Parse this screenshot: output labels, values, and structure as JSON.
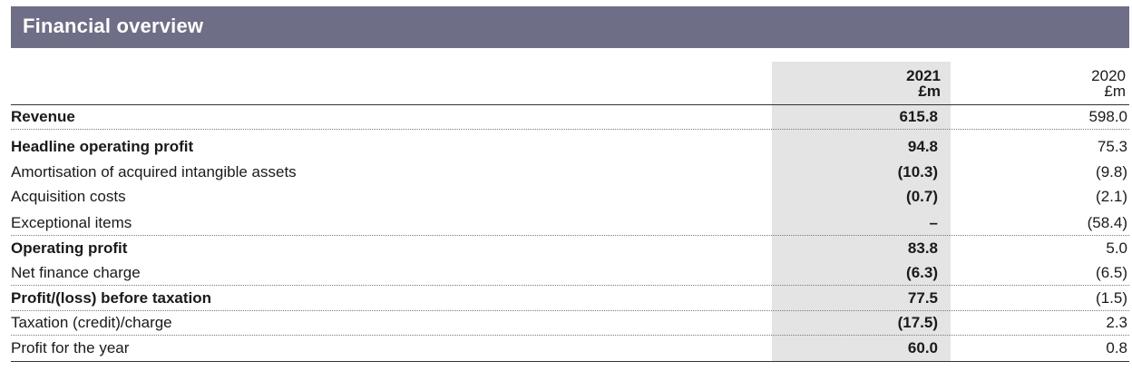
{
  "title": "Financial overview",
  "columns": [
    {
      "year": "2021",
      "unit": "£m"
    },
    {
      "year": "2020",
      "unit": "£m"
    }
  ],
  "rows": [
    {
      "label": "Revenue",
      "v2021": "615.8",
      "v2020": "598.0",
      "bold": true
    },
    {
      "label": "Headline operating profit",
      "v2021": "94.8",
      "v2020": "75.3",
      "bold": true
    },
    {
      "label": "Amortisation of acquired intangible assets",
      "v2021": "(10.3)",
      "v2020": "(9.8)",
      "bold": false
    },
    {
      "label": "Acquisition costs",
      "v2021": "(0.7)",
      "v2020": "(2.1)",
      "bold": false
    },
    {
      "label": "Exceptional items",
      "v2021": "–",
      "v2020": "(58.4)",
      "bold": false
    },
    {
      "label": "Operating profit",
      "v2021": "83.8",
      "v2020": "5.0",
      "bold": true
    },
    {
      "label": "Net finance charge",
      "v2021": "(6.3)",
      "v2020": "(6.5)",
      "bold": false
    },
    {
      "label": "Profit/(loss) before taxation",
      "v2021": "77.5",
      "v2020": "(1.5)",
      "bold": true
    },
    {
      "label": "Taxation (credit)/charge",
      "v2021": "(17.5)",
      "v2020": "2.3",
      "bold": false
    },
    {
      "label": "Profit for the year",
      "v2021": "60.0",
      "v2020": "0.8",
      "bold": false
    }
  ],
  "colors": {
    "banner": "#6e6e87",
    "shade": "#e4e4e4"
  }
}
